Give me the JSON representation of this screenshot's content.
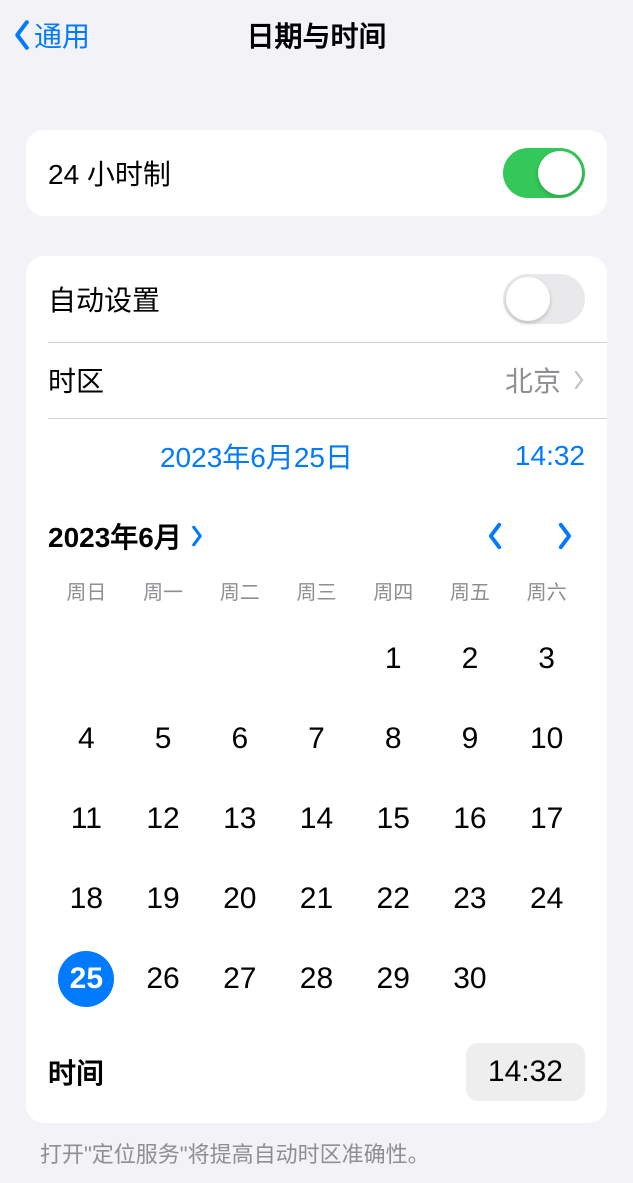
{
  "nav": {
    "back_label": "通用",
    "title": "日期与时间"
  },
  "settings": {
    "twenty_four_hour_label": "24 小时制",
    "twenty_four_hour_on": true,
    "auto_set_label": "自动设置",
    "auto_set_on": false,
    "timezone_label": "时区",
    "timezone_value": "北京"
  },
  "current": {
    "date_label": "2023年6月25日",
    "time_label": "14:32"
  },
  "calendar": {
    "month_label": "2023年6月",
    "weekdays": [
      "周日",
      "周一",
      "周二",
      "周三",
      "周四",
      "周五",
      "周六"
    ],
    "leading_blanks": 4,
    "days_in_month": 30,
    "selected_day": 25,
    "time_row_label": "时间",
    "time_value": "14:32"
  },
  "footer": {
    "hint": "打开\"定位服务\"将提高自动时区准确性。"
  }
}
